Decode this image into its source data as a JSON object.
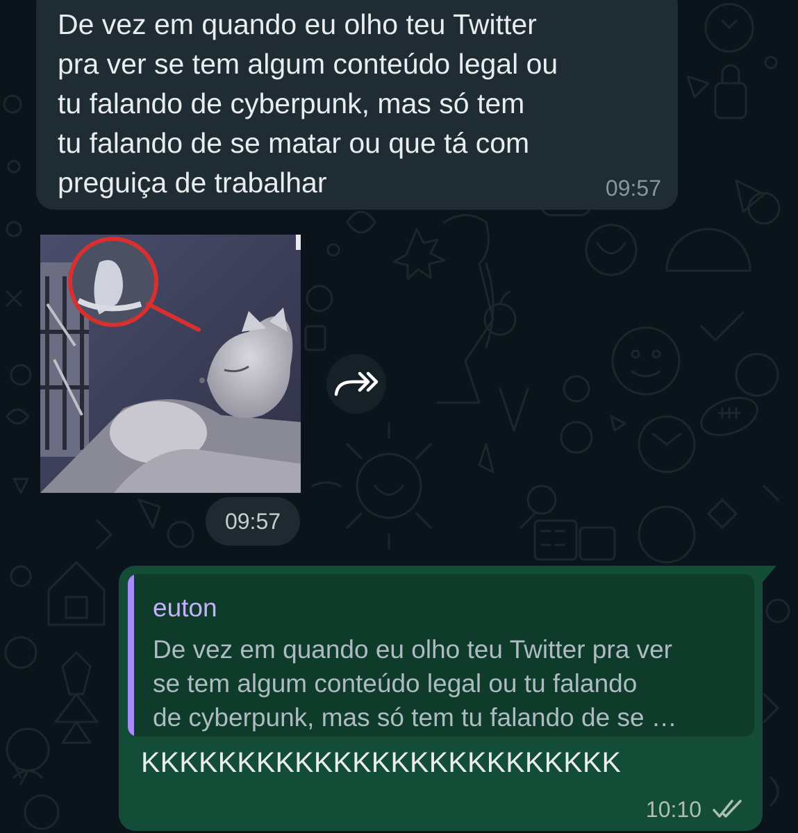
{
  "chat": {
    "incoming_message": {
      "text": "De vez em quando eu olho teu Twitter\npra ver se tem algum conteúdo legal ou\ntu falando de cyberpunk, mas só tem\ntu falando de se matar ou que tá com\npreguiça de trabalhar",
      "time": "09:57"
    },
    "incoming_media": {
      "kind": "image",
      "icon": "forward-icon",
      "time": "09:57"
    },
    "outgoing_message": {
      "quoted_author": "euton",
      "quoted_text": "De vez em quando eu olho teu Twitter pra ver\nse tem algum conteúdo legal ou tu falando\nde cyberpunk, mas só tem tu falando de se …",
      "text": "KKKKKKKKKKKKKKKKKKKKKKKKK",
      "time": "10:10",
      "status_icon": "double-check-icon"
    }
  },
  "colors": {
    "background": "#0b141a",
    "incoming_bubble": "#202c33",
    "outgoing_bubble": "#144d37",
    "quote_bar": "#a78bfa",
    "quote_author": "#c4b3fb"
  }
}
